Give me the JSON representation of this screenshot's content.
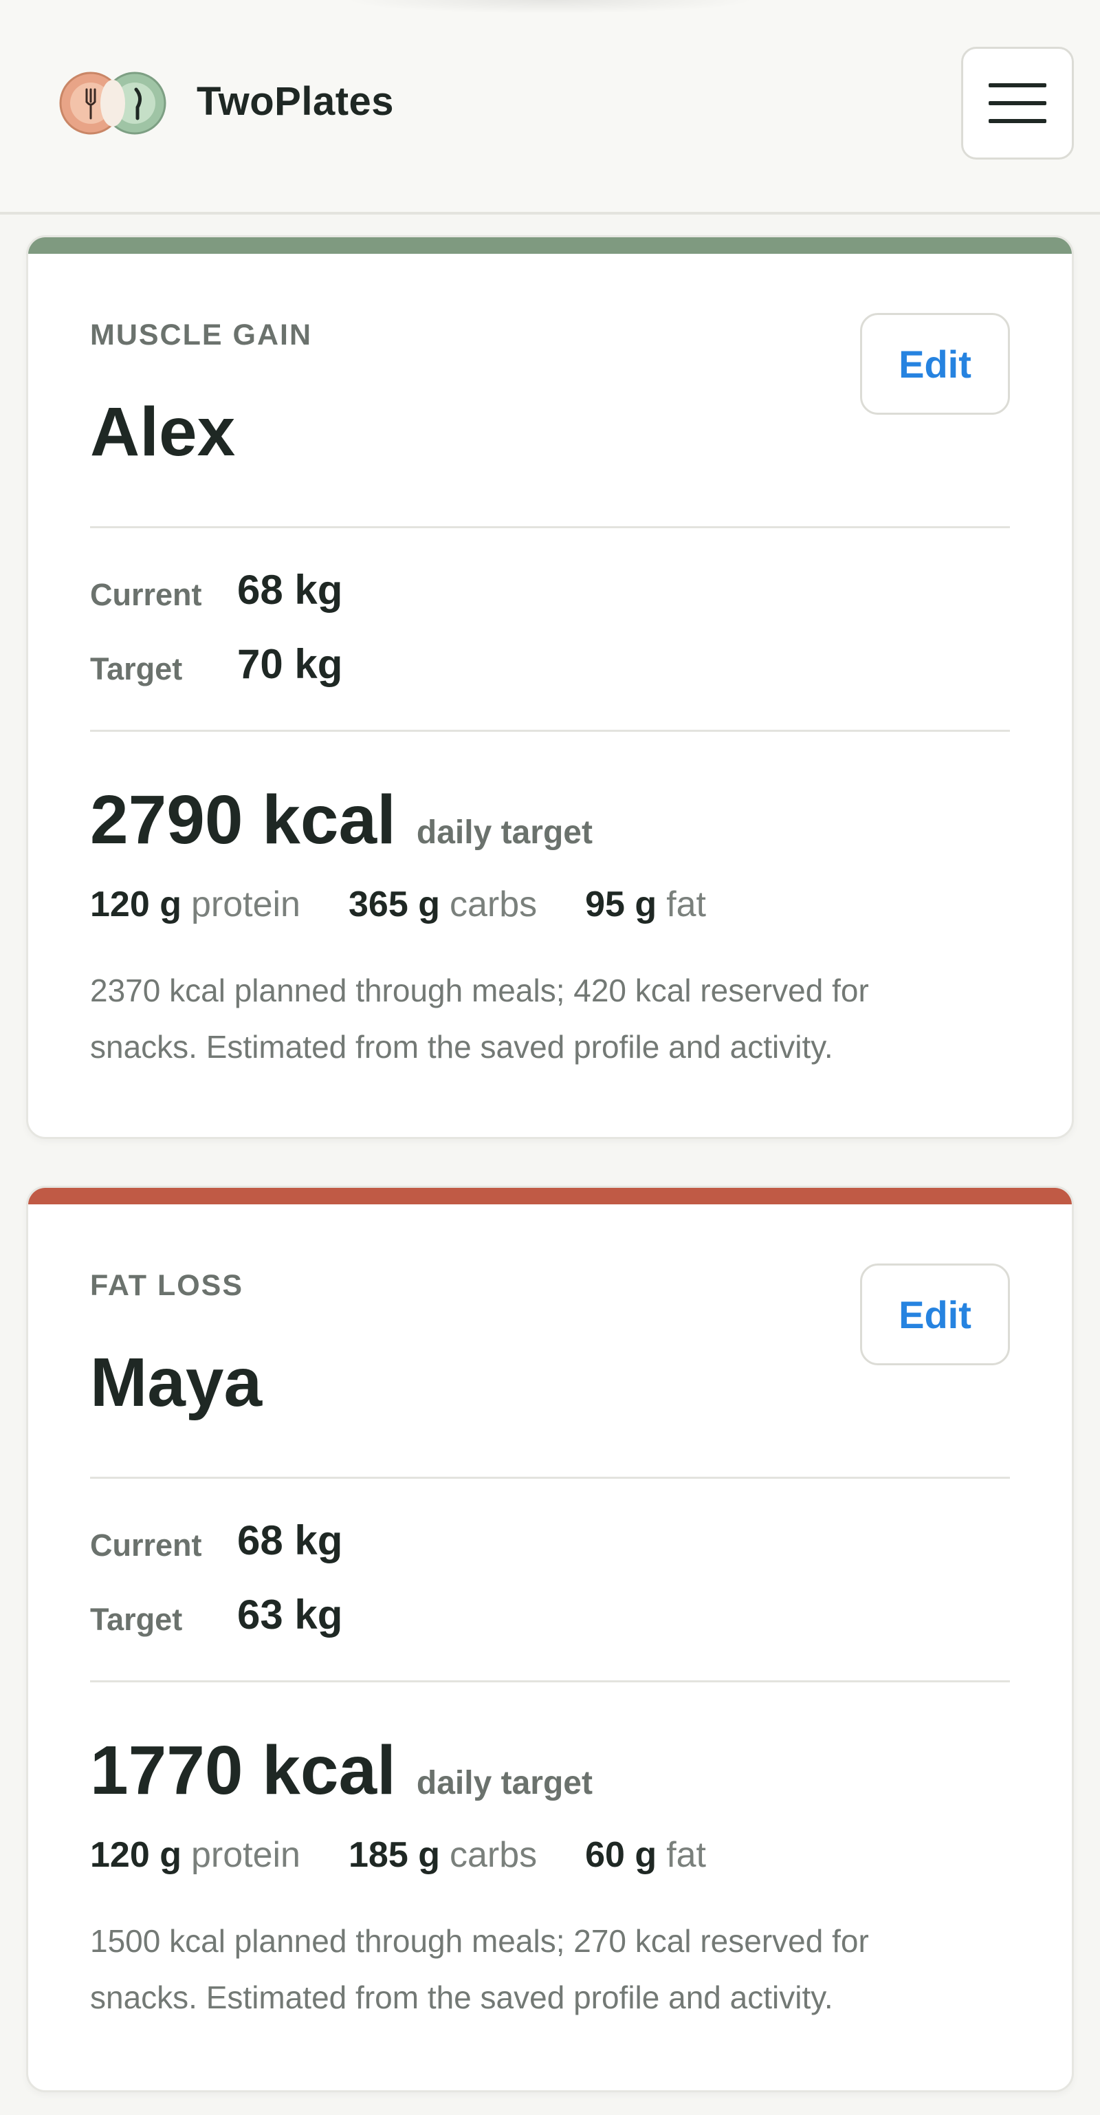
{
  "header": {
    "brand_name": "TwoPlates",
    "logo_icon": "two-plates-logo-icon",
    "menu_icon": "hamburger-menu-icon"
  },
  "profiles": [
    {
      "goal": "MUSCLE GAIN",
      "name": "Alex",
      "edit_label": "Edit",
      "accent_color": "#7f9a80",
      "current_label": "Current",
      "current_weight": "68 kg",
      "target_label": "Target",
      "target_weight": "70 kg",
      "kcal": "2790 kcal",
      "kcal_caption": "daily target",
      "macros": [
        {
          "amount": "120 g",
          "name": "protein"
        },
        {
          "amount": "365 g",
          "name": "carbs"
        },
        {
          "amount": "95 g",
          "name": "fat"
        }
      ],
      "note_line1": "2370 kcal planned through meals; 420 kcal reserved for",
      "note_line2": "snacks. Estimated from the saved profile and activity."
    },
    {
      "goal": "FAT LOSS",
      "name": "Maya",
      "edit_label": "Edit",
      "accent_color": "#c05a45",
      "current_label": "Current",
      "current_weight": "68 kg",
      "target_label": "Target",
      "target_weight": "63 kg",
      "kcal": "1770 kcal",
      "kcal_caption": "daily target",
      "macros": [
        {
          "amount": "120 g",
          "name": "protein"
        },
        {
          "amount": "185 g",
          "name": "carbs"
        },
        {
          "amount": "60 g",
          "name": "fat"
        }
      ],
      "note_line1": "1500 kcal planned through meals; 270 kcal reserved for",
      "note_line2": "snacks. Estimated from the saved profile and activity."
    }
  ]
}
